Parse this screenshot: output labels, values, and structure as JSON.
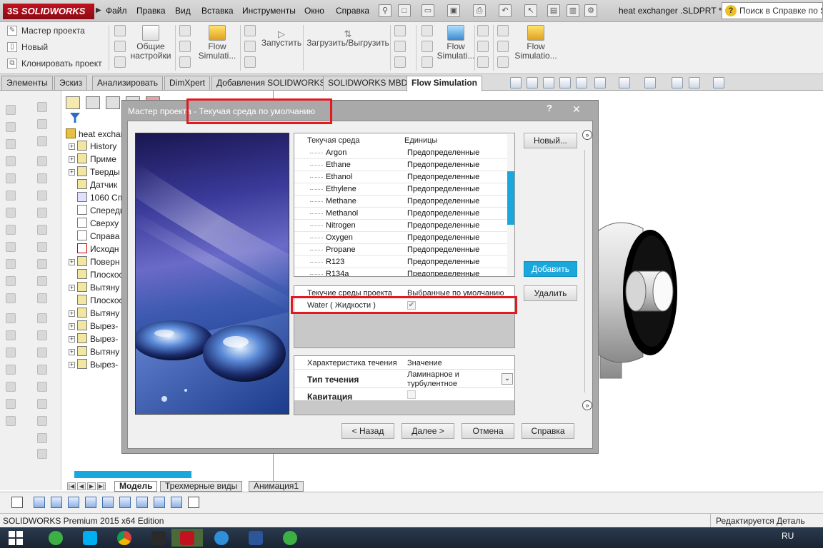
{
  "app": {
    "logo_text": "SOLIDWORKS",
    "logo_prefix": "3S",
    "document_title": "heat exchanger .SLDPRT *",
    "help_search_placeholder": "Поиск в Справке по S"
  },
  "menu": [
    "Файл",
    "Правка",
    "Вид",
    "Вставка",
    "Инструменты",
    "Окно",
    "Справка"
  ],
  "command_manager": {
    "small_items": [
      "Мастер проекта",
      "Новый",
      "Клонировать проект"
    ],
    "general_settings": "Общие\nнастройки",
    "flow_sim_1": "Flow\nSimulati...",
    "run": "Запустить",
    "load_unload": "Загрузить/Выгрузить",
    "flow_sim_2": "Flow\nSimulati...",
    "flow_sim_3": "Flow\nSimulatio..."
  },
  "tabs": [
    {
      "label": "Элементы",
      "active": false
    },
    {
      "label": "Эскиз",
      "active": false
    },
    {
      "label": "Анализировать",
      "active": false
    },
    {
      "label": "DimXpert",
      "active": false
    },
    {
      "label": "Добавления SOLIDWORKS",
      "active": false
    },
    {
      "label": "SOLIDWORKS MBD",
      "active": false
    },
    {
      "label": "Flow Simulation",
      "active": true
    }
  ],
  "feature_manager": {
    "root": "heat exchan",
    "items": [
      {
        "label": "History",
        "expandable": true
      },
      {
        "label": "Приме",
        "expandable": true
      },
      {
        "label": "Тверды",
        "expandable": true
      },
      {
        "label": "Датчик",
        "expandable": false
      },
      {
        "label": "1060 Сп",
        "expandable": false
      },
      {
        "label": "Спереди",
        "expandable": false
      },
      {
        "label": "Сверху",
        "expandable": false
      },
      {
        "label": "Справа",
        "expandable": false
      },
      {
        "label": "Исходн",
        "expandable": false
      },
      {
        "label": "Поверн",
        "expandable": true
      },
      {
        "label": "Плоскос",
        "expandable": false
      },
      {
        "label": "Вытяну",
        "expandable": true
      },
      {
        "label": "Плоскос",
        "expandable": false
      },
      {
        "label": "Вытяну",
        "expandable": true
      },
      {
        "label": "Вырез-",
        "expandable": true
      },
      {
        "label": "Вырез-",
        "expandable": true
      },
      {
        "label": "Вытяну",
        "expandable": true
      },
      {
        "label": "Вырез-",
        "expandable": true
      }
    ],
    "bottom_tabs": [
      {
        "label": "Модель",
        "active": true
      },
      {
        "label": "Трехмерные виды",
        "active": false
      },
      {
        "label": "Анимация1",
        "active": false
      }
    ]
  },
  "dialog": {
    "title_prefix": "Мастер проекта",
    "title_suffix": " - Текучая среда по умолчанию",
    "help_glyph": "?",
    "close_glyph": "✕",
    "fluids_header": {
      "col1": "Текучая среда",
      "col2": "Единицы"
    },
    "fluids": [
      {
        "name": "Argon",
        "units": "Предопределенные"
      },
      {
        "name": "Ethane",
        "units": "Предопределенные"
      },
      {
        "name": "Ethanol",
        "units": "Предопределенные"
      },
      {
        "name": "Ethylene",
        "units": "Предопределенные"
      },
      {
        "name": "Methane",
        "units": "Предопределенные"
      },
      {
        "name": "Methanol",
        "units": "Предопределенные"
      },
      {
        "name": "Nitrogen",
        "units": "Предопределенные"
      },
      {
        "name": "Oxygen",
        "units": "Предопределенные"
      },
      {
        "name": "Propane",
        "units": "Предопределенные"
      },
      {
        "name": "R123",
        "units": "Предопределенные"
      },
      {
        "name": "R134a",
        "units": "Предопределенные"
      }
    ],
    "project_header": {
      "col1": "Текучие среды проекта",
      "col2": "Выбранные по умолчанию"
    },
    "project_fluid": {
      "name": "Water ( Жидкости )",
      "default_checked": true
    },
    "flow_header": {
      "col1": "Характеристика течения",
      "col2": "Значение"
    },
    "flow_type_label": "Тип течения",
    "flow_type_value": "Ламинарное и\nтурбулентное",
    "cavitation_label": "Кавитация",
    "cavitation_checked": false,
    "buttons": {
      "new": "Новый...",
      "add": "Добавить",
      "remove": "Удалить",
      "back": "< Назад",
      "next": "Далее >",
      "cancel": "Отмена",
      "help": "Справка"
    }
  },
  "status": {
    "left": "SOLIDWORKS Premium 2015 x64 Edition",
    "right": "Редактируется Деталь"
  },
  "taskbar": {
    "language": "RU",
    "apps": [
      "utorrent",
      "skype",
      "chrome",
      "game",
      "solidworks-2015",
      "kompas",
      "word",
      "clover"
    ]
  },
  "colors": {
    "highlight_red": "#e51820",
    "accent_blue": "#1aa8dc",
    "solidworks_red": "#c1121f"
  }
}
